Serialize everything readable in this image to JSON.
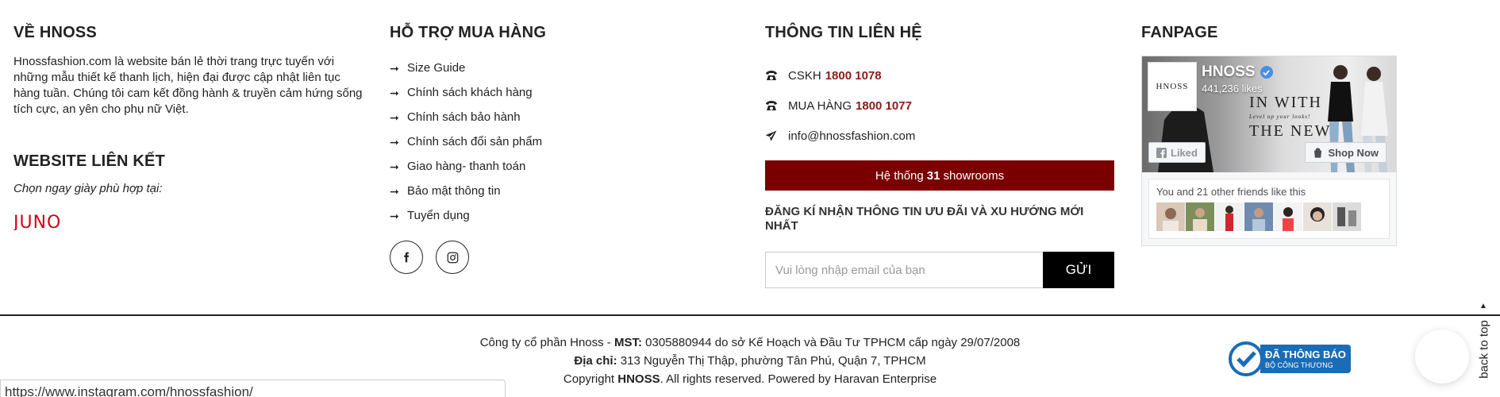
{
  "about": {
    "title": "VỀ HNOSS",
    "text": "Hnossfashion.com là website bán lẻ thời trang trực tuyến với những mẫu thiết kế thanh lịch, hiện đại được cập nhật liên tục hàng tuần. Chúng tôi cam kết đồng hành & truyền cảm hứng sống tích cực, an yên cho phụ nữ Việt."
  },
  "links": {
    "title": "WEBSITE LIÊN KẾT",
    "subtitle": "Chọn ngay giày phù hợp tại:",
    "juno_logo": "JUNO",
    "juno_color": "#d0021b"
  },
  "support": {
    "title": "HỖ TRỢ MUA HÀNG",
    "items": [
      {
        "label": "Size Guide"
      },
      {
        "label": "Chính sách khách hàng"
      },
      {
        "label": "Chính sách bảo hành"
      },
      {
        "label": "Chính sách đổi sản phẩm"
      },
      {
        "label": "Giao hàng- thanh toán"
      },
      {
        "label": "Bảo mật thông tin"
      },
      {
        "label": "Tuyển dụng"
      }
    ],
    "socials": [
      {
        "icon": "facebook-icon"
      },
      {
        "icon": "instagram-icon"
      }
    ]
  },
  "contact": {
    "title": "THÔNG TIN LIÊN HỆ",
    "cskh_label": "CSKH",
    "cskh_number": "1800 1078",
    "mua_label": "MUA HÀNG",
    "mua_number": "1800 1077",
    "email": "info@hnossfashion.com",
    "showroom_prefix": "Hệ thống",
    "showroom_count": "31",
    "showroom_suffix": "showrooms",
    "newsletter_title": "ĐĂNG KÍ NHẬN THÔNG TIN ƯU ĐÃI VÀ XU HƯỚNG MỚI NHẤT",
    "email_placeholder": "Vui lòng nhập email của bạn",
    "submit_label": "GỬI",
    "accent_color": "#7a0000"
  },
  "fanpage": {
    "title": "FANPAGE",
    "page_name": "HNOSS",
    "logo_text": "HNOSS",
    "likes": "441,236 likes",
    "cover_line1": "IN WITH",
    "cover_line2": "Level up your looks!",
    "cover_line3": "THE NEW",
    "liked_label": "Liked",
    "shop_label": "Shop Now",
    "friends_text": "You and 21 other friends like this"
  },
  "footer": {
    "line1_prefix": "Công ty cổ phần Hnoss - ",
    "mst_label": "MST:",
    "line1_suffix": " 0305880944 do sở Kế Hoạch và Đầu Tư TPHCM cấp ngày 29/07/2008",
    "address_label": "Địa chỉ:",
    "address": " 313 Nguyễn Thị Thập, phường Tân Phú, Quận 7, TPHCM",
    "copyright_prefix": "Copyright ",
    "copyright_brand": "HNOSS",
    "copyright_suffix": ". All rights reserved. Powered by Haravan Enterprise",
    "badge_line1": "ĐÃ THÔNG BÁO",
    "badge_line2": "BỘ CÔNG THƯƠNG",
    "back_to_top": "back to top",
    "status_url": "https://www.instagram.com/hnossfashion/"
  }
}
